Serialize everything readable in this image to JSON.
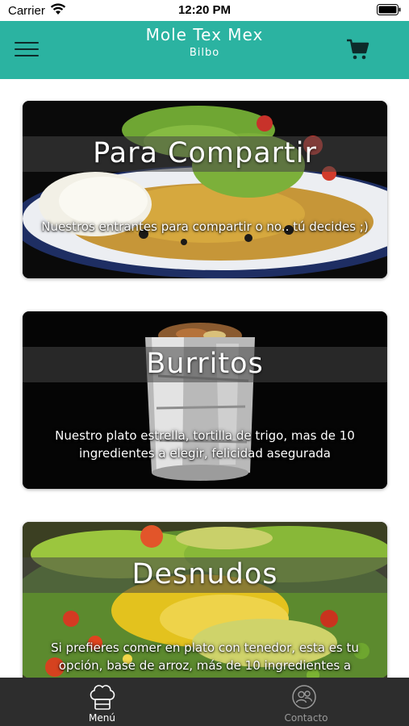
{
  "status_bar": {
    "carrier": "Carrier",
    "time": "12:20 PM"
  },
  "header": {
    "title": "Mole Tex Mex",
    "subtitle": "Bilbo",
    "menu_icon": "hamburger-menu-icon",
    "cart_icon": "shopping-cart-icon",
    "background_color": "#2bb3a1"
  },
  "categories": [
    {
      "title": "Para Compartir",
      "description": "Nuestros entrantes para compartir o no.. tú decides ;)"
    },
    {
      "title": "Burritos",
      "description": "Nuestro plato estrella, tortilla de trigo, mas de 10 ingredientes a elegir, felicidad asegurada"
    },
    {
      "title": "Desnudos",
      "description": "Si prefieres comer en plato con tenedor, esta es tu opción, base de arroz, más de 10 ingredientes a"
    }
  ],
  "tab_bar": {
    "items": [
      {
        "label": "Menú",
        "icon": "chef-hat-icon",
        "active": true
      },
      {
        "label": "Contacto",
        "icon": "contact-people-icon",
        "active": false
      }
    ],
    "background_color": "#2d2d2d"
  }
}
